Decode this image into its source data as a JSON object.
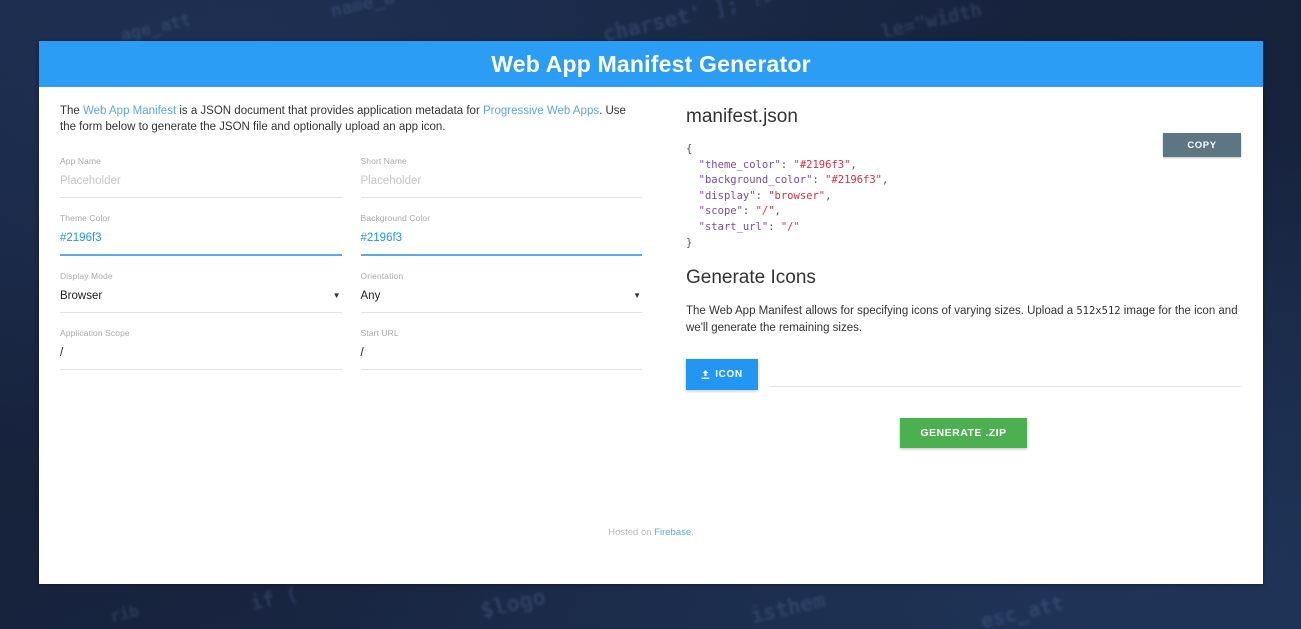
{
  "header": {
    "title": "Web App Manifest Generator"
  },
  "intro": {
    "prefix": "The ",
    "link1": "Web App Manifest",
    "middle": " is a JSON document that provides application metadata for ",
    "link2": "Progressive Web Apps",
    "suffix": ". Use the form below to generate the JSON file and optionally upload an app icon."
  },
  "form": {
    "fields": [
      {
        "label": "App Name",
        "value": "Placeholder",
        "is_placeholder": true,
        "accent": false,
        "active": false,
        "type": "text"
      },
      {
        "label": "Short Name",
        "value": "Placeholder",
        "is_placeholder": true,
        "accent": false,
        "active": false,
        "type": "text"
      },
      {
        "label": "Theme Color",
        "value": "#2196f3",
        "is_placeholder": false,
        "accent": true,
        "active": true,
        "type": "text"
      },
      {
        "label": "Background Color",
        "value": "#2196f3",
        "is_placeholder": false,
        "accent": true,
        "active": true,
        "type": "text"
      },
      {
        "label": "Display Mode",
        "value": "Browser",
        "is_placeholder": false,
        "accent": false,
        "active": false,
        "type": "select"
      },
      {
        "label": "Orientation",
        "value": "Any",
        "is_placeholder": false,
        "accent": false,
        "active": false,
        "type": "select"
      },
      {
        "label": "Application Scope",
        "value": "/",
        "is_placeholder": false,
        "accent": false,
        "active": false,
        "type": "text"
      },
      {
        "label": "Start URL",
        "value": "/",
        "is_placeholder": false,
        "accent": false,
        "active": false,
        "type": "text"
      }
    ],
    "select_caret": "▼"
  },
  "manifest": {
    "heading": "manifest.json",
    "copy_label": "COPY",
    "lines": [
      {
        "indent": 0,
        "text": "{",
        "type": "punct"
      },
      {
        "indent": 1,
        "key": "\"theme_color\"",
        "sep": ": ",
        "value": "\"#2196f3\"",
        "trail": ","
      },
      {
        "indent": 1,
        "key": "\"background_color\"",
        "sep": ": ",
        "value": "\"#2196f3\"",
        "trail": ","
      },
      {
        "indent": 1,
        "key": "\"display\"",
        "sep": ": ",
        "value": "\"browser\"",
        "trail": ","
      },
      {
        "indent": 1,
        "key": "\"scope\"",
        "sep": ": ",
        "value": "\"/\"",
        "trail": ","
      },
      {
        "indent": 1,
        "key": "\"start_url\"",
        "sep": ": ",
        "value": "\"/\"",
        "trail": ""
      },
      {
        "indent": 0,
        "text": "}",
        "type": "punct"
      }
    ]
  },
  "generate_icons": {
    "heading": "Generate Icons",
    "desc_part1": "The Web App Manifest allows for specifying icons of varying sizes. Upload a ",
    "desc_size": "512x512",
    "desc_part2": " image for the icon and we'll generate the remaining sizes.",
    "icon_button_label": "ICON",
    "zip_button_label": "GENERATE .ZIP"
  },
  "footer": {
    "prefix": "Hosted on ",
    "link": "Firebase",
    "suffix": "."
  },
  "colors": {
    "titlebar": "#2b9df4",
    "accent": "#2196f3",
    "copy_button": "#5c7683",
    "zip_button": "#4caf50",
    "backdrop": "#17233d",
    "json_key": "#7d49a8",
    "json_value": "#d9303e"
  },
  "backdrop_text": [
    "charset' ]; ?><meta",
    "le=\"width",
    "if (",
    "$logo",
    "isthem",
    "esc_att",
    "age_att",
    "rib",
    "name_a"
  ]
}
